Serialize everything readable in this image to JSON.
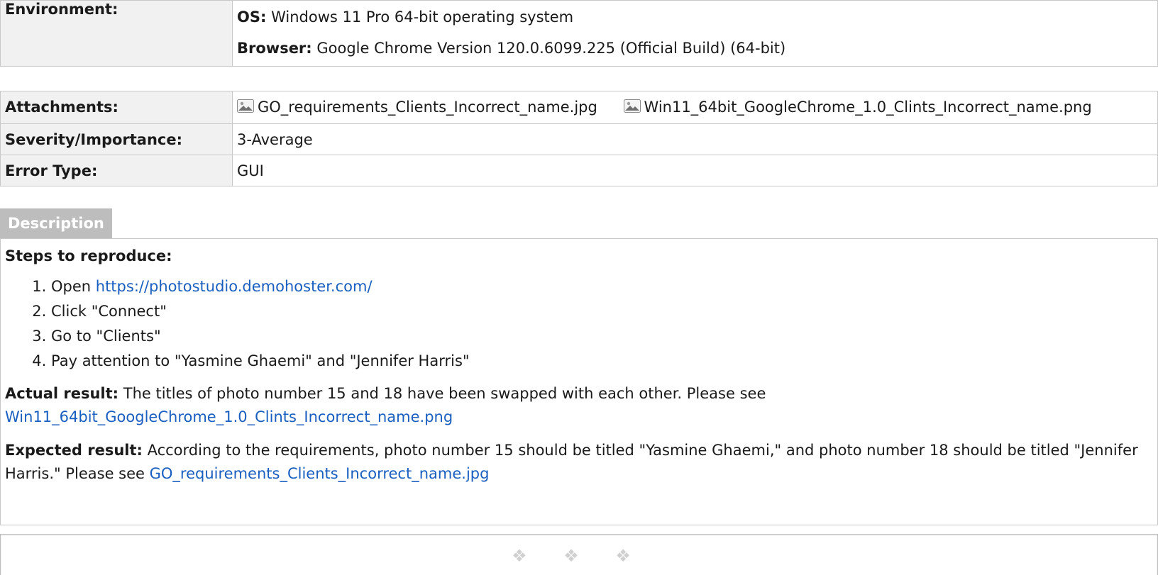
{
  "environment": {
    "label": "Environment:",
    "os_label": "OS:",
    "os_value": "Windows 11 Pro 64-bit operating system",
    "browser_label": "Browser:",
    "browser_value": "Google Chrome Version 120.0.6099.225 (Official Build) (64-bit)"
  },
  "attachments": {
    "label": "Attachments:",
    "files": [
      {
        "name": "GO_requirements_Clients_Incorrect_name.jpg",
        "icon": "image-file-icon"
      },
      {
        "name": "Win11_64bit_GoogleChrome_1.0_Clints_Incorrect_name.png",
        "icon": "image-file-icon"
      }
    ]
  },
  "severity": {
    "label": "Severity/Importance:",
    "value": "3-Average"
  },
  "error_type": {
    "label": "Error Type:",
    "value": "GUI"
  },
  "description": {
    "tab_label": "Description",
    "steps_title": "Steps to reproduce:",
    "steps": [
      {
        "prefix": "Open ",
        "link": "https://photostudio.demohoster.com/"
      },
      {
        "text": "Click \"Connect\""
      },
      {
        "text": "Go to \"Clients\""
      },
      {
        "text": "Pay attention to \"Yasmine Ghaemi\" and \"Jennifer Harris\""
      }
    ],
    "actual": {
      "label": "Actual result:",
      "text": " The titles of photo number 15 and 18 have been swapped with each other. Please see ",
      "link": "Win11_64bit_GoogleChrome_1.0_Clints_Incorrect_name.png"
    },
    "expected": {
      "label": "Expected result:",
      "text": " According to the requirements, photo number 15 should be titled \"Yasmine Ghaemi,\" and photo number 18 should be titled \"Jennifer Harris.\" Please see ",
      "link": "GO_requirements_Clients_Incorrect_name.jpg"
    }
  },
  "footer": {
    "ornament": "❖ ❖ ❖"
  },
  "colors": {
    "link": "#1a5fc0",
    "label_bg": "#f1f1f1",
    "tab_bg": "#bdbdbd",
    "border": "#c8c8c8"
  }
}
